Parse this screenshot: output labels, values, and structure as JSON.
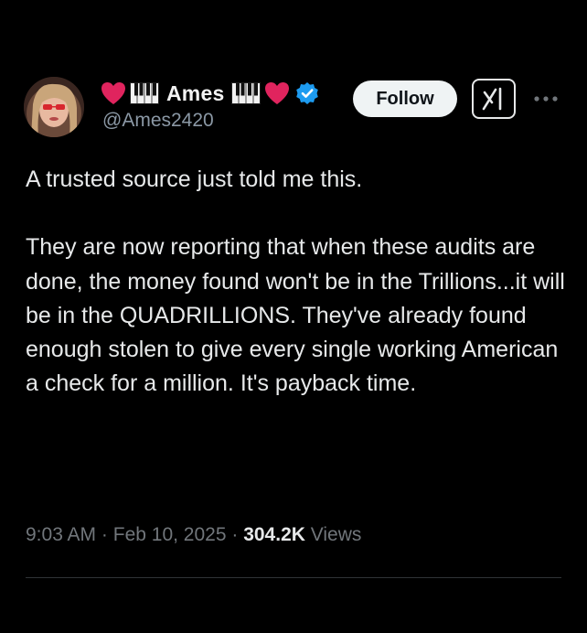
{
  "author": {
    "display_name": "Ames",
    "handle": "@Ames2420",
    "verified": true,
    "name_decorations": [
      "heart-icon",
      "piano-keys-icon",
      "piano-keys-icon",
      "heart-icon"
    ]
  },
  "header": {
    "follow_label": "Follow",
    "grok_icon": "grok-icon",
    "more_icon": "more-dots-icon"
  },
  "tweet": {
    "paragraphs": [
      "A trusted source just told me this.",
      "They are now reporting that when these audits are done, the money found won't be in the Trillions...it will be in the QUADRILLIONS. They've already found enough stolen to give every single working American a check for a million. It's payback time."
    ]
  },
  "meta": {
    "time": "9:03 AM",
    "separator": "·",
    "date": "Feb 10, 2025",
    "views_count": "304.2K",
    "views_label": "Views"
  },
  "colors": {
    "background": "#000000",
    "text_primary": "#e7e9ea",
    "text_secondary": "#71767b",
    "verified_badge": "#1d9bf0",
    "heart": "#e0245e",
    "follow_button_bg": "#eff3f4"
  }
}
